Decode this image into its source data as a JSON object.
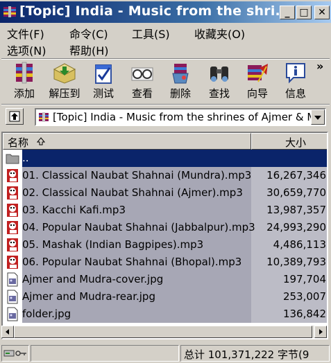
{
  "window": {
    "title": "[Topic] India - Music from the shri...",
    "minimize": "_",
    "maximize": "□",
    "close": "✕"
  },
  "menu": [
    {
      "label": "文件(F)"
    },
    {
      "label": "命令(C)"
    },
    {
      "label": "工具(S)"
    },
    {
      "label": "收藏夹(O)"
    },
    {
      "label": "选项(N)"
    },
    {
      "label": "帮助(H)"
    }
  ],
  "toolbar": {
    "buttons": [
      {
        "label": "添加",
        "icon": "add-archive-icon"
      },
      {
        "label": "解压到",
        "icon": "extract-icon"
      },
      {
        "label": "测试",
        "icon": "test-icon"
      },
      {
        "label": "查看",
        "icon": "view-icon"
      },
      {
        "label": "删除",
        "icon": "delete-icon"
      },
      {
        "label": "查找",
        "icon": "find-icon"
      },
      {
        "label": "向导",
        "icon": "wizard-icon"
      },
      {
        "label": "信息",
        "icon": "info-icon"
      }
    ],
    "more": "»"
  },
  "address": {
    "path": "[Topic] India - Music from the shrines of Ajmer & Mu"
  },
  "list": {
    "columns": {
      "name": "名称",
      "size": "大小"
    },
    "rows": [
      {
        "name": "..",
        "size": "",
        "type": "folder",
        "selected": true
      },
      {
        "name": "01. Classical Naubat Shahnai (Mundra).mp3",
        "size": "16,267,346",
        "type": "mp3"
      },
      {
        "name": "02. Classical Naubat Shahnai (Ajmer).mp3",
        "size": "30,659,770",
        "type": "mp3"
      },
      {
        "name": "03. Kacchi Kafi.mp3",
        "size": "13,987,357",
        "type": "mp3"
      },
      {
        "name": "04. Popular Naubat Shahnai (Jabbalpur).mp3",
        "size": "24,993,290",
        "type": "mp3"
      },
      {
        "name": "05. Mashak (Indian Bagpipes).mp3",
        "size": "4,486,113",
        "type": "mp3"
      },
      {
        "name": "06. Popular Naubat Shahnai (Bhopal).mp3",
        "size": "10,389,793",
        "type": "mp3"
      },
      {
        "name": "Ajmer and Mudra-cover.jpg",
        "size": "197,704",
        "type": "jpg"
      },
      {
        "name": "Ajmer and Mudra-rear.jpg",
        "size": "253,007",
        "type": "jpg"
      },
      {
        "name": "folder.jpg",
        "size": "136,842",
        "type": "jpg"
      }
    ]
  },
  "status": {
    "total": "总计 101,371,222 字节(9"
  }
}
